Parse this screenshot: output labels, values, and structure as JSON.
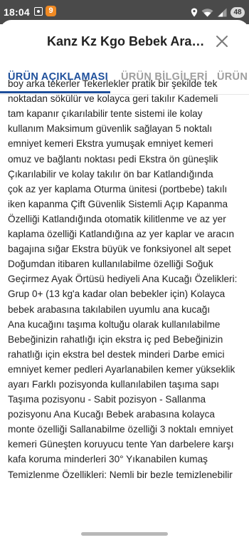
{
  "status_bar": {
    "time": "18:04",
    "app_badge": "9",
    "battery": "48",
    "background": "#4a4a4a"
  },
  "sheet": {
    "title": "Kanz Kz Kgo Bebek Arabası",
    "close_icon": "close-icon"
  },
  "tabs": [
    {
      "label": "ÜRÜN AÇIKLAMASI",
      "active": true
    },
    {
      "label": "ÜRÜN BİLGİLERİ",
      "active": false
    },
    {
      "label": "ÜRÜN",
      "active": false
    }
  ],
  "accent_color": "#1e4f9b",
  "description": "Ekstra büyük ve fonksiyonel alt sepet Katlanabilir\nboy arka tekerler Tekerlekler pratik bir şekilde tek\nnoktadan sökülür ve kolayca geri takılır Kademeli\ntam kapanır çıkarılabilir tente sistemi ile kolay\nkullanım Maksimum güvenlik sağlayan 5 noktalı\nemniyet kemeri Ekstra yumuşak emniyet kemeri\nomuz ve bağlantı noktası pedi Ekstra ön güneşlik\nÇıkarılabilir ve kolay takılır ön bar Katlandığında\nçok az yer kaplama Oturma ünitesi (portbebe) takılı\niken kapanma Çift Güvenlik Sistemli Açıp Kapanma\nÖzelliği Katlandığında otomatik kilitlenme ve az yer\nkaplama özelliği Katlandığına az yer kaplar ve aracın\nbagajına sığar Ekstra büyük ve fonksiyonel alt sepet\nDoğumdan itibaren kullanılabilme özelliği Soğuk\nGeçirmez Ayak Örtüsü hediyeli Ana Kucağı Özelikleri:\nGrup 0+ (13 kg'a kadar olan bebekler için) Kolayca\nbebek arabasına takılabilen uyumlu ana kucağı\nAna kucağını taşıma koltuğu olarak kullanılabilme\nBebeğinizin rahatlığı için ekstra iç ped Bebeğinizin\nrahatlığı için ekstra bel destek minderi Darbe emici\nemniyet kemer pedleri Ayarlanabilen kemer yükseklik\nayarı Farklı pozisyonda kullanılabilen taşıma sapı\nTaşıma pozisyonu - Sabit pozisyon - Sallanma\npozisyonu Ana Kucağı Bebek arabasına kolayca\nmonte özelliği Sallanabilme özelliği 3 noktalı emniyet\nkemeri Güneşten koruyucu tente Yan darbelere karşı\nkafa koruma minderleri 30° Yıkanabilen kumaş\nTemizlenme Özellikleri: Nemli bir bezle temizlenebilir"
}
